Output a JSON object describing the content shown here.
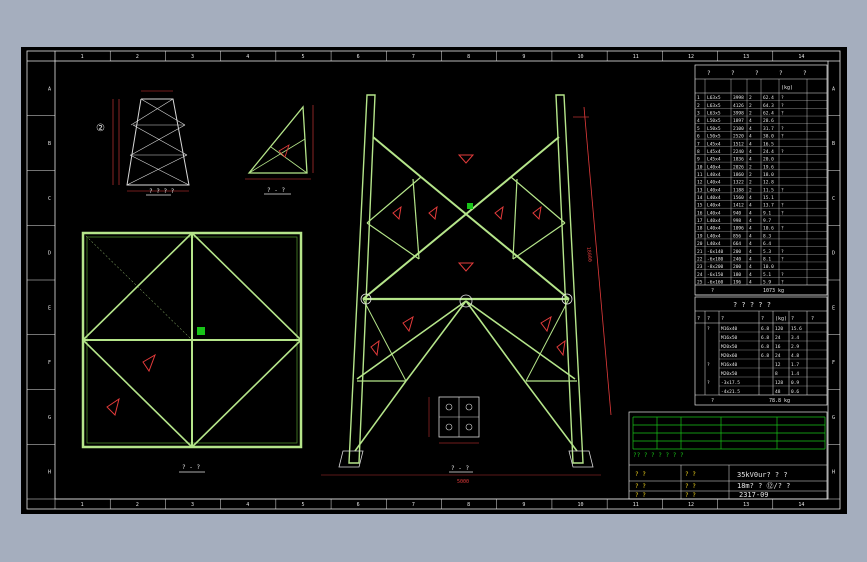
{
  "colors": {
    "background": "#a5aebe",
    "sheet": "#000000",
    "frame": "#e6e6e6",
    "member": "#b5e58a",
    "member_dark": "#4a8a2a",
    "dimension": "#e33b3b",
    "green_table": "#18c418"
  },
  "border": {
    "columns": [
      "1",
      "2",
      "3",
      "4",
      "5",
      "6",
      "7",
      "8",
      "9",
      "10",
      "11",
      "12",
      "13",
      "14"
    ],
    "rows": [
      "A",
      "B",
      "C",
      "D",
      "E",
      "F",
      "G",
      "H"
    ]
  },
  "views": {
    "small_elevation_label": "? ? ? ?",
    "plan_label": "? - ?",
    "gusset_label": "? - ?",
    "base_detail_label": "? - ?",
    "small_elevation_circle": "②",
    "small_triangle_label": "? - ?"
  },
  "material_table": {
    "header_top": [
      "?",
      "?",
      "?",
      "?",
      "?"
    ],
    "unit_header": "(kg)",
    "rows": [
      [
        "1",
        "L63x5",
        "3998",
        "2",
        "62.4",
        "?"
      ],
      [
        "2",
        "L63x5",
        "4126",
        "2",
        "64.3",
        "?"
      ],
      [
        "3",
        "L63x5",
        "3998",
        "2",
        "62.4",
        "?"
      ],
      [
        "4",
        "L50x5",
        "1897",
        "4",
        "28.6",
        ""
      ],
      [
        "5",
        "L50x5",
        "2100",
        "4",
        "31.7",
        "?"
      ],
      [
        "6",
        "L50x5",
        "2520",
        "4",
        "38.0",
        "?"
      ],
      [
        "7",
        "L45x4",
        "1512",
        "4",
        "16.5",
        ""
      ],
      [
        "8",
        "L45x4",
        "2240",
        "4",
        "24.4",
        "?"
      ],
      [
        "9",
        "L45x4",
        "1836",
        "4",
        "20.0",
        ""
      ],
      [
        "10",
        "L40x4",
        "2026",
        "2",
        "19.6",
        ""
      ],
      [
        "11",
        "L40x4",
        "1860",
        "2",
        "18.0",
        ""
      ],
      [
        "12",
        "L40x4",
        "1322",
        "2",
        "12.8",
        ""
      ],
      [
        "13",
        "L40x4",
        "1188",
        "2",
        "11.5",
        "?"
      ],
      [
        "14",
        "L40x4",
        "1560",
        "4",
        "15.1",
        ""
      ],
      [
        "15",
        "L40x4",
        "1412",
        "4",
        "13.7",
        "?"
      ],
      [
        "16",
        "L40x4",
        "940",
        "4",
        "9.1",
        "?"
      ],
      [
        "17",
        "L40x4",
        "998",
        "4",
        "9.7",
        ""
      ],
      [
        "18",
        "L40x4",
        "1096",
        "4",
        "10.6",
        "?"
      ],
      [
        "19",
        "L40x4",
        "856",
        "4",
        "8.3",
        ""
      ],
      [
        "20",
        "L40x4",
        "664",
        "4",
        "6.4",
        ""
      ],
      [
        "21",
        "-6x140",
        "200",
        "4",
        "5.3",
        "?"
      ],
      [
        "22",
        "-6x180",
        "240",
        "4",
        "8.1",
        "?"
      ],
      [
        "23",
        "-8x200",
        "200",
        "4",
        "10.0",
        ""
      ],
      [
        "24",
        "-6x150",
        "180",
        "4",
        "5.1",
        "?"
      ],
      [
        "25",
        "-6x160",
        "196",
        "4",
        "5.9",
        "?"
      ]
    ],
    "total_label": "?",
    "total_value": "1073 kg"
  },
  "bolt_table": {
    "title": "? ? ? ? ?",
    "headers": [
      "?",
      "?",
      "?",
      "?",
      "(kg)",
      "?",
      "?"
    ],
    "rows": [
      [
        "?",
        "M16x40",
        "6.8",
        "120",
        "15.6",
        ""
      ],
      [
        "",
        "M16x50",
        "6.8",
        "24",
        "3.4",
        ""
      ],
      [
        "",
        "M20x50",
        "6.8",
        "16",
        "2.9",
        ""
      ],
      [
        "",
        "M20x60",
        "6.8",
        "24",
        "4.8",
        ""
      ],
      [
        "?",
        "M16x40",
        "",
        "12",
        "1.7",
        ""
      ],
      [
        "",
        "M20x50",
        "",
        "8",
        "1.4",
        ""
      ],
      [
        "?",
        "-3x17.5",
        "",
        "128",
        "0.9",
        ""
      ],
      [
        "",
        "-4x21.5",
        "",
        "48",
        "0.6",
        ""
      ]
    ],
    "total_label": "?",
    "total_value": "78.8 kg"
  },
  "title_block": {
    "green_row_text": "?? ? ? ? ? ? ?",
    "label_left_1": "? ?",
    "label_left_2": "? ?",
    "label_left_3": "? ?",
    "label_mid_1": "? ?",
    "label_mid_2": "? ?",
    "label_mid_3": "? ?",
    "project_title": "35kV0ur? ? ?",
    "drawing_title": "18m? ?  ⑫/? ?",
    "drawing_number": "2317-09"
  },
  "tower": {
    "height_dimension": "18000",
    "base_dimension": "5000"
  }
}
